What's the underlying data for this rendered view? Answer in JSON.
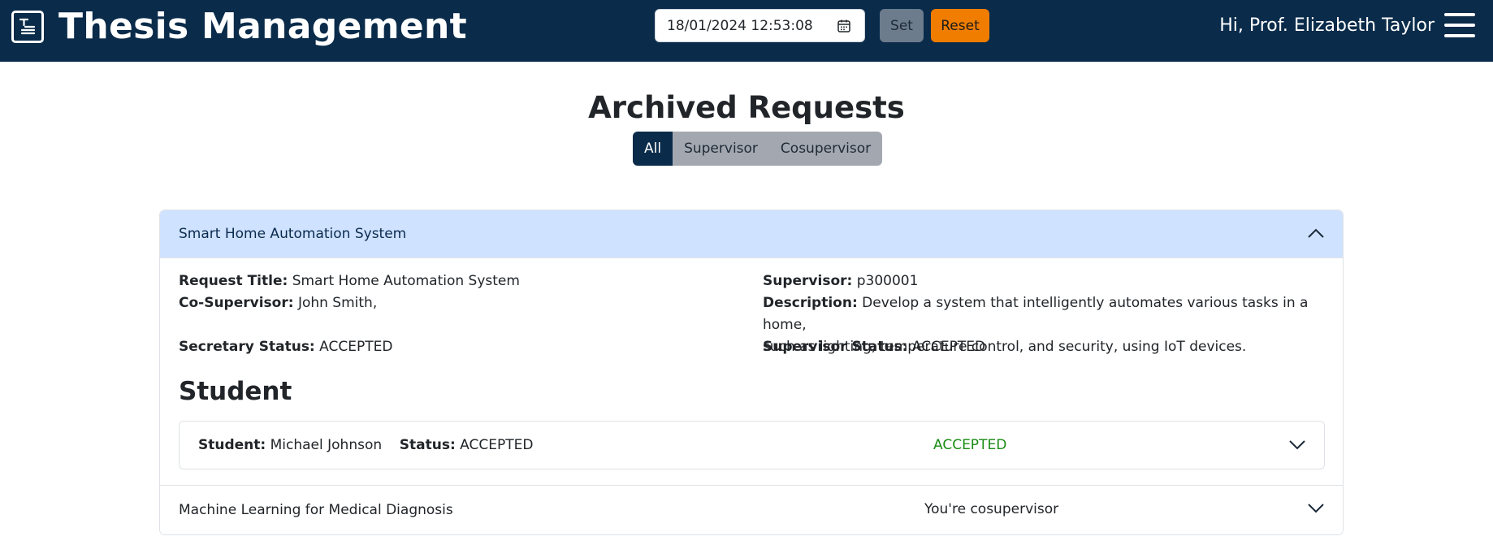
{
  "app": {
    "title": "Thesis Management"
  },
  "toolbar": {
    "datetime_value": "18/01/2024 12:53:08",
    "set_label": "Set",
    "reset_label": "Reset",
    "greeting": "Hi, Prof. Elizabeth Taylor"
  },
  "page": {
    "title": "Archived Requests",
    "filters": [
      "All",
      "Supervisor",
      "Cosupervisor"
    ],
    "active_filter": "All"
  },
  "requests": [
    {
      "title": "Smart Home Automation System",
      "expanded": true,
      "details": {
        "request_title_label": "Request Title:",
        "request_title": "Smart Home Automation System",
        "cosupervisor_label": "Co-Supervisor:",
        "cosupervisor": "John Smith,",
        "secretary_status_label": "Secretary Status:",
        "secretary_status": "ACCEPTED",
        "supervisor_label": "Supervisor:",
        "supervisor": "p300001",
        "description_label": "Description:",
        "description_line1": "Develop a system that intelligently automates various tasks in a home,",
        "description_line2": "such as lighting, temperature control, and security, using IoT devices.",
        "supervisor_status_label": "Supervisor Status:",
        "supervisor_status": "ACCEPTED"
      },
      "student_heading": "Student",
      "student": {
        "student_label": "Student:",
        "name": "Michael Johnson",
        "status_label": "Status:",
        "status": "ACCEPTED",
        "badge": "ACCEPTED"
      }
    },
    {
      "title": "Machine Learning for Medical Diagnosis",
      "expanded": false,
      "role": "You're cosupervisor"
    }
  ],
  "colors": {
    "navbar": "#0a2b4a",
    "reset_button": "#f07d00",
    "set_button": "#6c7c8d",
    "accordion_open_header": "#cfe2ff",
    "accepted_text": "#1a8b14"
  },
  "icons": [
    "document-logo-icon",
    "calendar-icon",
    "menu-icon",
    "chevron-up-icon",
    "chevron-down-icon"
  ]
}
